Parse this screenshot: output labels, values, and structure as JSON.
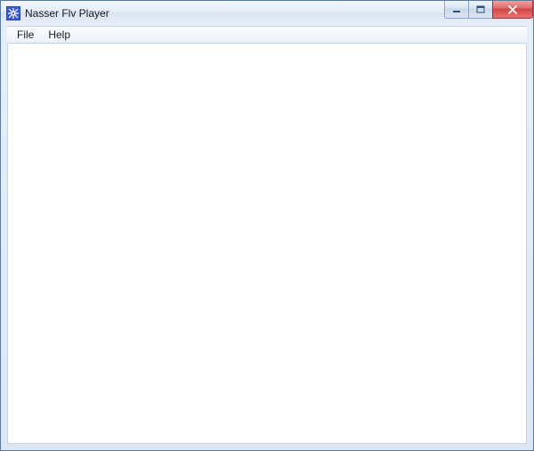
{
  "window": {
    "title": "Nasser Flv Player"
  },
  "menubar": {
    "items": [
      {
        "label": "File"
      },
      {
        "label": "Help"
      }
    ]
  }
}
